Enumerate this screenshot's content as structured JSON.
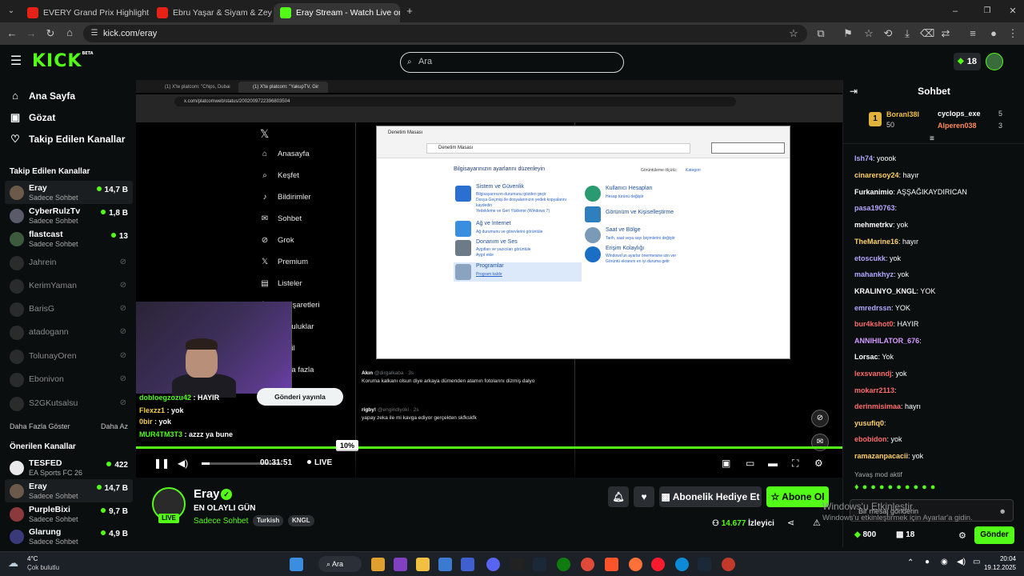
{
  "browser": {
    "tabs": [
      {
        "title": "EVERY Grand Prix Highlight of 2",
        "icon": "youtube-icon"
      },
      {
        "title": "Ebru Yaşar & Siyam & Zeyd",
        "icon": "youtube-icon"
      },
      {
        "title": "Eray Stream - Watch Live on Ki",
        "icon": "kick-icon"
      }
    ],
    "url": "kick.com/eray"
  },
  "header": {
    "logo": "KICK",
    "logo_badge": "BETA",
    "search_placeholder": "Ara",
    "points": "18"
  },
  "sidebar": {
    "nav": [
      {
        "label": "Ana Sayfa",
        "icon": "home-icon"
      },
      {
        "label": "Gözat",
        "icon": "browse-icon"
      },
      {
        "label": "Takip Edilen Kanallar",
        "icon": "heart-icon"
      }
    ],
    "followed_title": "Takip Edilen Kanallar",
    "followed": [
      {
        "name": "Eray",
        "sub": "Sadece Sohbet",
        "viewers": "14,7 B",
        "live": true
      },
      {
        "name": "CyberRulzTv",
        "sub": "Sadece Sohbet",
        "viewers": "1,8 B",
        "live": true
      },
      {
        "name": "flastcast",
        "sub": "Sadece Sohbet",
        "viewers": "13",
        "live": true
      },
      {
        "name": "Jahrein",
        "live": false
      },
      {
        "name": "KerimYaman",
        "live": false
      },
      {
        "name": "BarisG",
        "live": false
      },
      {
        "name": "atadogann",
        "live": false
      },
      {
        "name": "TolunayOren",
        "live": false
      },
      {
        "name": "Ebonivon",
        "live": false
      },
      {
        "name": "S2GKutsalsu",
        "live": false
      }
    ],
    "show_more": "Daha Fazla Göster",
    "show_less": "Daha Az",
    "recommended_title": "Önerilen Kanallar",
    "recommended": [
      {
        "name": "TESFED",
        "sub": "EA Sports FC 26",
        "viewers": "422"
      },
      {
        "name": "Eray",
        "sub": "Sadece Sohbet",
        "viewers": "14,7 B"
      },
      {
        "name": "PurpleBixi",
        "sub": "Sadece Sohbet",
        "viewers": "9,7 B"
      },
      {
        "name": "Glarung",
        "sub": "Sadece Sohbet",
        "viewers": "4,9 B"
      }
    ]
  },
  "stream": {
    "inner_tabs": [
      "(1) X'te platcom: \"Chips, Dubai",
      "(1) X'te platcom: \"YakupTV, Gir"
    ],
    "inner_url": "x.com/platcomweb/status/2002009722396803504",
    "x_nav": [
      "Anasayfa",
      "Keşfet",
      "Bildirimler",
      "Sohbet",
      "Grok",
      "Premium",
      "Listeler",
      "Yer işaretleri",
      "Topluluklar",
      "Profil",
      "Daha fazla"
    ],
    "tweet_button": "Gönderi yayınla",
    "control_panel": {
      "title": "Denetim Masası",
      "path": "Denetim Masası",
      "heading": "Bilgisayarınızın ayarlarını düzenleyin",
      "view_by": "Görüntüleme ölçütü:",
      "view_value": "Kategori",
      "left": [
        {
          "title": "Sistem ve Güvenlik",
          "links": [
            "Bilgisayarınızın durumunu gözden geçir",
            "Dosya Geçmişi ile dosyalarınızın yedek kopyalarını kaydedin",
            "Yedekleme ve Geri Yükleme (Windows 7)"
          ]
        },
        {
          "title": "Ağ ve İnternet",
          "links": [
            "Ağ durumunu ve görevlerini görüntüle"
          ]
        },
        {
          "title": "Donanım ve Ses",
          "links": [
            "Aygıtları ve yazıcıları görüntüle",
            "Aygıt ekle"
          ]
        },
        {
          "title": "Programlar",
          "links": [
            "Program kaldır"
          ]
        }
      ],
      "right": [
        {
          "title": "Kullanıcı Hesapları",
          "links": [
            "Hesap türünü değiştir"
          ]
        },
        {
          "title": "Görünüm ve Kişiselleştirme",
          "links": []
        },
        {
          "title": "Saat ve Bölge",
          "links": [
            "Tarih, saat veya sayı biçimlerini değiştir"
          ]
        },
        {
          "title": "Erişim Kolaylığı",
          "links": [
            "Windows'un ayarlar önermesine izin ver",
            "Görüntü ekranını en iyi duruma getir"
          ]
        }
      ]
    },
    "tweets": [
      {
        "name": "Akın",
        "handle": "@dirgalkaba · 3s",
        "text": "Koruma kalkanı olsun diye arkaya dümenden atamın fotolarını dizmiş dalyo"
      },
      {
        "name": "rigby!",
        "handle": "@engindiyoki · 2s",
        "text": "yapay zeka ile mi kavga ediyor gerçekten skfkskfk"
      }
    ],
    "overlay_chat": [
      {
        "user": "dobloegzozu42",
        "text": "HAYIR",
        "color": "#53fc18"
      },
      {
        "user": "Flexzz1",
        "text": "yok",
        "color": "#f4d03f"
      },
      {
        "user": "0bir",
        "text": "yok",
        "color": "#f4d03f"
      },
      {
        "user": "MUR4TM3T3",
        "text": "azzz ya bune",
        "color": "#53fc18"
      }
    ],
    "volume_tooltip": "10%",
    "volume": 0.1,
    "time": "00:31:51",
    "live_label": "LIVE"
  },
  "channel": {
    "name": "Eray",
    "title": "EN OLAYLI GÜN",
    "category": "Sadece Sohbet",
    "tags": [
      "Turkish",
      "KNGL"
    ],
    "live_badge": "LIVE",
    "gift_button": "Abonelik Hediye Et",
    "subscribe_button": "Abone Ol",
    "viewers": "14.677",
    "viewers_label": "İzleyici"
  },
  "chat": {
    "title": "Sohbet",
    "leaderboard": [
      {
        "rank": "1",
        "name": "Boranl38l",
        "count": "50"
      },
      {
        "name": "cyclops_exe",
        "count": "5"
      },
      {
        "name": "Alperen038",
        "count": "3"
      }
    ],
    "messages": [
      {
        "user": "Ish74",
        "text": "yoook",
        "color": "#b4a7ff"
      },
      {
        "user": "cinarersoy24",
        "text": "hayır",
        "color": "#ffd166"
      },
      {
        "user": "Furkanimio",
        "text": "AŞŞAĞIKAYDIRICAN",
        "color": "#ffffff"
      },
      {
        "user": "pasa190763",
        "text": "",
        "color": "#b4a7ff"
      },
      {
        "user": "mehmetrkv",
        "text": "yok",
        "color": "#ffffff"
      },
      {
        "user": "TheMarine16",
        "text": "hayır",
        "color": "#ffd166"
      },
      {
        "user": "etoscukk",
        "text": "yok",
        "color": "#b4a7ff"
      },
      {
        "user": "mahankhyz",
        "text": "yok",
        "color": "#b4a7ff"
      },
      {
        "user": "KRALINYO_KNGL",
        "text": "YOK",
        "color": "#ffffff"
      },
      {
        "user": "emredrssn",
        "text": "YOK",
        "color": "#b4a7ff"
      },
      {
        "user": "bur4kshot0",
        "text": "HAYIR",
        "color": "#ff6b6b"
      },
      {
        "user": "ANNIHILATOR_676",
        "text": "",
        "color": "#d29bff"
      },
      {
        "user": "Lorsac",
        "text": "Yok",
        "color": "#ffffff"
      },
      {
        "user": "lexsvanndj",
        "text": "yok",
        "color": "#ff6b6b"
      },
      {
        "user": "mokarr2113",
        "text": "",
        "color": "#ff6b6b"
      },
      {
        "user": "derinmisimaa",
        "text": "hayrı",
        "color": "#ff6b6b"
      },
      {
        "user": "yusufiq0",
        "text": "",
        "color": "#ffd166"
      },
      {
        "user": "ebobidon",
        "text": "yok",
        "color": "#ff6b6b"
      },
      {
        "user": "ramazanpacacii",
        "text": "yok",
        "color": "#ffd166"
      }
    ],
    "slow_mode": "Yavaş mod aktif",
    "input_placeholder": "Bir mesaj gönderin",
    "activation_title": "Windows'u Etkinleştir",
    "activation_text": "Windows'u etkinleştirmek için Ayarlar'a gidin.",
    "balance": "800",
    "gifts": "18",
    "send_button": "Gönder"
  },
  "taskbar": {
    "weather_temp": "4°C",
    "weather_text": "Çok bulutlu",
    "search": "Ara",
    "time": "20:04",
    "date": "19.12.2025"
  }
}
